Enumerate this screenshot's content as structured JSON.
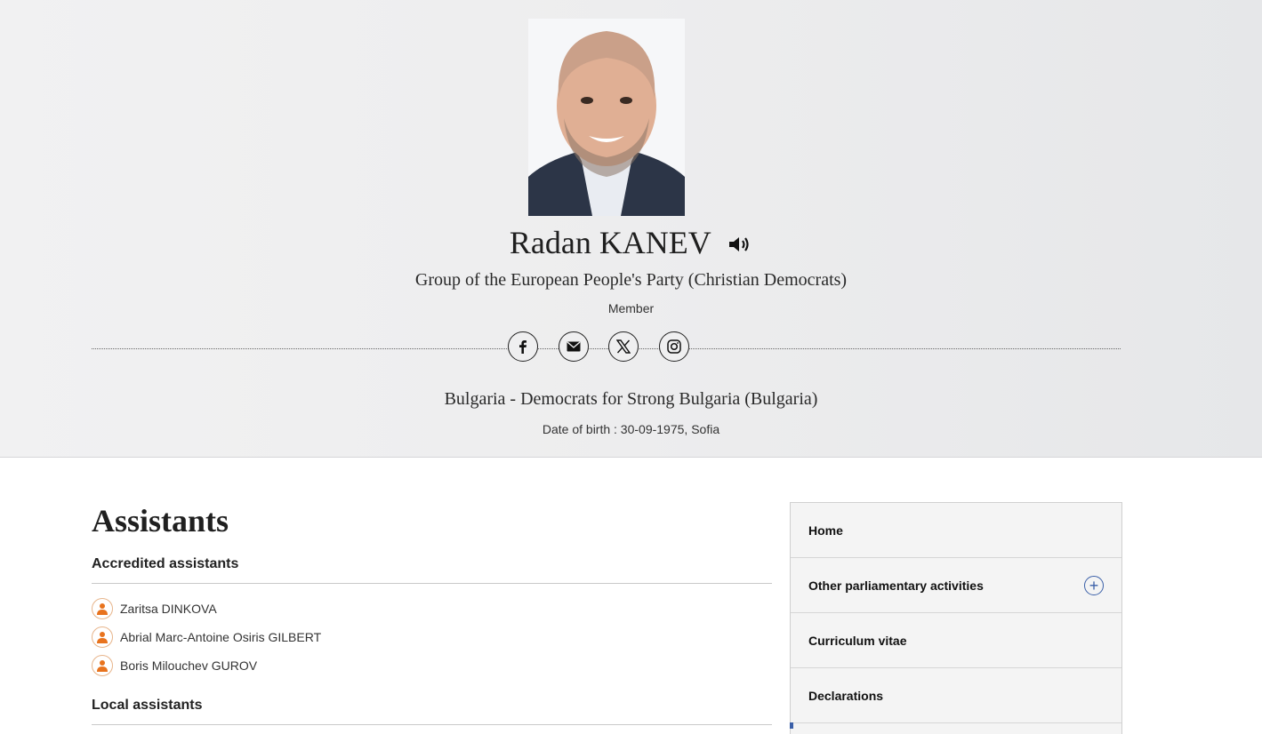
{
  "profile": {
    "name": "Radan KANEV",
    "group": "Group of the European People's Party (Christian Democrats)",
    "role": "Member",
    "country": "Bulgaria - Democrats for Strong Bulgaria (Bulgaria)",
    "dob": "Date of birth : 30-09-1975, Sofia"
  },
  "socials": [
    {
      "icon": "facebook-icon"
    },
    {
      "icon": "email-icon"
    },
    {
      "icon": "x-icon"
    },
    {
      "icon": "instagram-icon"
    }
  ],
  "main": {
    "title": "Assistants",
    "accredited_title": "Accredited assistants",
    "accredited": [
      "Zaritsa DINKOVA",
      "Abrial Marc-Antoine Osiris GILBERT",
      "Boris Milouchev GUROV"
    ],
    "local_title": "Local assistants"
  },
  "sidebar": {
    "items": [
      {
        "label": "Home"
      },
      {
        "label": "Other parliamentary activities",
        "expandable": true
      },
      {
        "label": "Curriculum vitae"
      },
      {
        "label": "Declarations"
      }
    ]
  },
  "colors": {
    "accent": "#3a5fa8",
    "avatar": "#e8731e"
  }
}
